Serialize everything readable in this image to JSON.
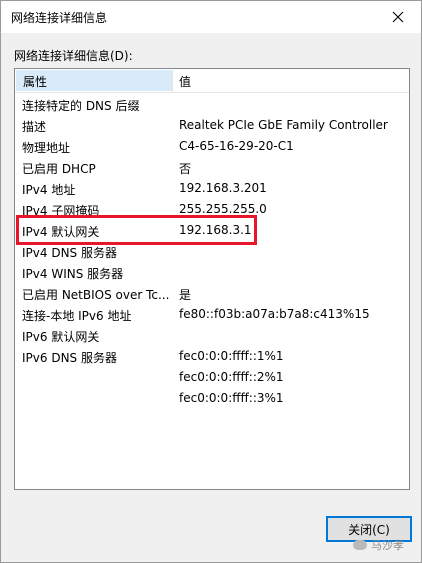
{
  "window": {
    "title": "网络连接详细信息"
  },
  "group_label": "网络连接详细信息(D):",
  "header": {
    "property": "属性",
    "value": "值"
  },
  "rows": [
    {
      "prop": "连接特定的 DNS 后缀",
      "val": ""
    },
    {
      "prop": "描述",
      "val": "Realtek PCIe GbE Family Controller"
    },
    {
      "prop": "物理地址",
      "val": "C4-65-16-29-20-C1"
    },
    {
      "prop": "已启用 DHCP",
      "val": "否"
    },
    {
      "prop": "IPv4 地址",
      "val": "192.168.3.201"
    },
    {
      "prop": "IPv4 子网掩码",
      "val": "255.255.255.0"
    },
    {
      "prop": "IPv4 默认网关",
      "val": "192.168.3.1"
    },
    {
      "prop": "IPv4 DNS 服务器",
      "val": ""
    },
    {
      "prop": "IPv4 WINS 服务器",
      "val": ""
    },
    {
      "prop": "已启用 NetBIOS over Tc...",
      "val": "是"
    },
    {
      "prop": "连接-本地 IPv6 地址",
      "val": "fe80::f03b:a07a:b7a8:c413%15"
    },
    {
      "prop": "IPv6 默认网关",
      "val": ""
    },
    {
      "prop": "IPv6 DNS 服务器",
      "val": "fec0:0:0:ffff::1%1"
    },
    {
      "prop": "",
      "val": "fec0:0:0:ffff::2%1"
    },
    {
      "prop": "",
      "val": "fec0:0:0:ffff::3%1"
    }
  ],
  "close_button": {
    "label": "关闭(C)"
  },
  "watermark": {
    "text": "马沙孝"
  },
  "colors": {
    "highlight": "#e8152b",
    "header_selected": "#d9ebf9",
    "button_focus": "#0078d7"
  }
}
